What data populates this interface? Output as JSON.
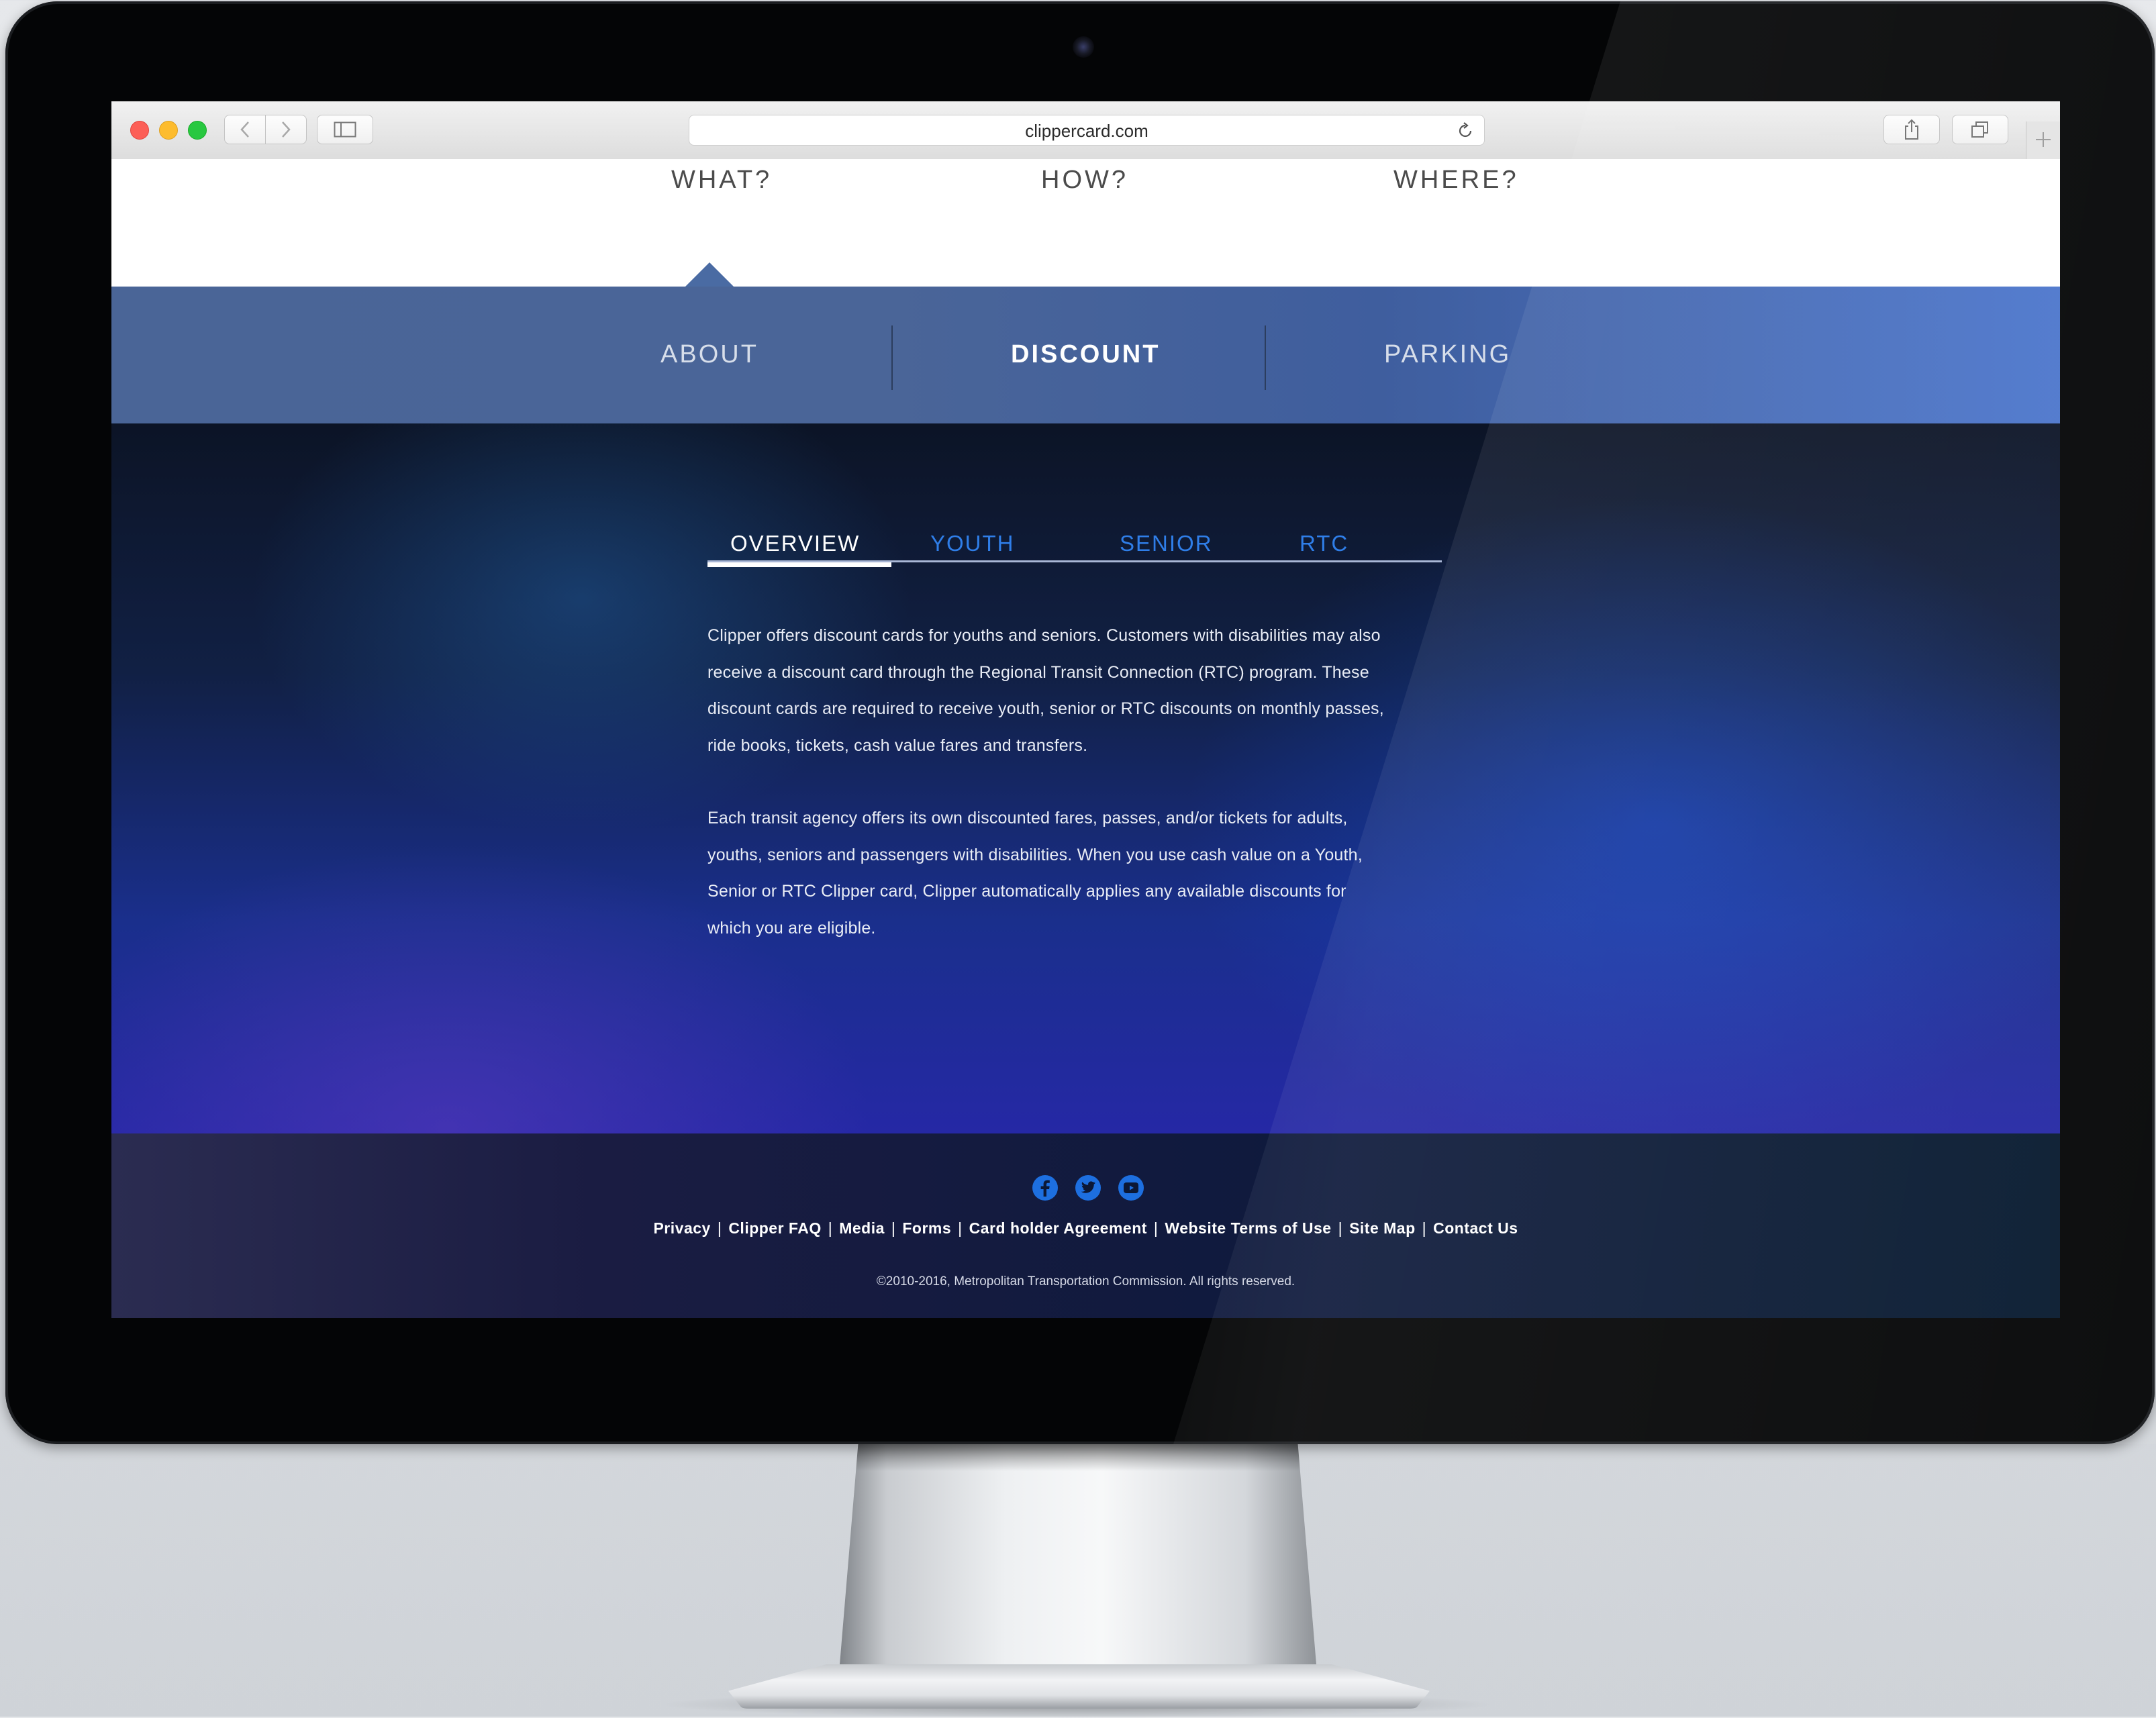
{
  "browser": {
    "url": "clippercard.com"
  },
  "top_nav": {
    "items": [
      "WHAT?",
      "HOW?",
      "WHERE?"
    ]
  },
  "sub_nav": {
    "items": [
      "ABOUT",
      "DISCOUNT",
      "PARKING"
    ],
    "active": "DISCOUNT"
  },
  "content_tabs": {
    "items": [
      "OVERVIEW",
      "YOUTH",
      "SENIOR",
      "RTC"
    ],
    "active": "OVERVIEW"
  },
  "content": {
    "paragraph_1": [
      "Clipper offers discount cards for youths and seniors. Customers with disabilities may also",
      "receive a discount card through the Regional Transit Connection (RTC) program. These",
      "discount cards are required to receive youth, senior or RTC discounts on monthly passes,",
      "ride books, tickets, cash value fares and transfers."
    ],
    "paragraph_2": [
      "Each transit agency offers its own discounted fares, passes, and/or tickets for adults,",
      "youths, seniors and passengers with disabilities. When you use cash value on a Youth,",
      "Senior or RTC Clipper card, Clipper automatically applies any available discounts for",
      "which you are eligible."
    ]
  },
  "footer": {
    "social_icons": [
      "facebook-icon",
      "twitter-icon",
      "youtube-icon"
    ],
    "links": [
      "Privacy",
      "Clipper FAQ",
      "Media",
      "Forms",
      "Card holder Agreement",
      "Website Terms of Use",
      "Site Map",
      "Contact Us"
    ],
    "separator": "|",
    "copyright": "©2010-2016, Metropolitan Transportation Commission. All rights reserved."
  },
  "colors": {
    "subnav_blue": "#4a6597",
    "tab_blue": "#2f7ee8",
    "social_blue": "#1d6fe0"
  }
}
